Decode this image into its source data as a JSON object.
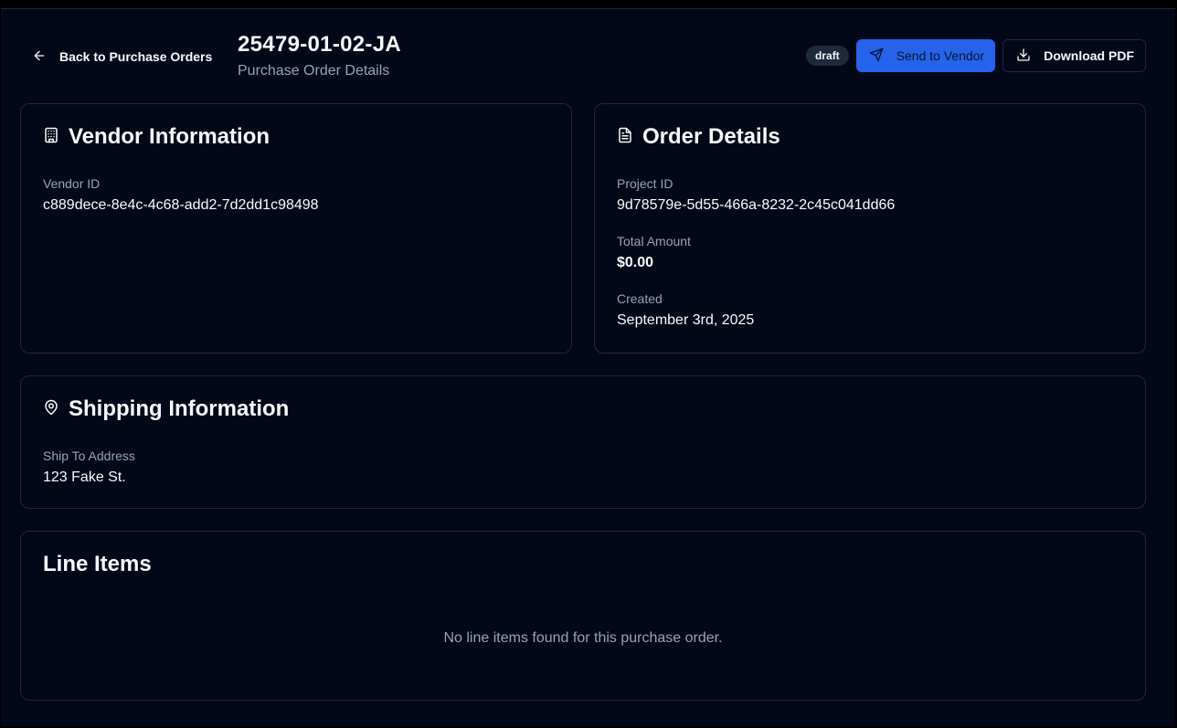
{
  "header": {
    "back_label": "Back to Purchase Orders",
    "po_number": "25479-01-02-JA",
    "subtitle": "Purchase Order Details",
    "status_badge": "draft",
    "send_label": "Send to Vendor",
    "download_label": "Download PDF"
  },
  "vendor": {
    "title": "Vendor Information",
    "vendor_id_label": "Vendor ID",
    "vendor_id": "c889dece-8e4c-4c68-add2-7d2dd1c98498"
  },
  "order": {
    "title": "Order Details",
    "project_id_label": "Project ID",
    "project_id": "9d78579e-5d55-466a-8232-2c45c041dd66",
    "total_label": "Total Amount",
    "total": "$0.00",
    "created_label": "Created",
    "created": "September 3rd, 2025"
  },
  "shipping": {
    "title": "Shipping Information",
    "address_label": "Ship To Address",
    "address": "123 Fake St."
  },
  "line_items": {
    "title": "Line Items",
    "empty_message": "No line items found for this purchase order."
  },
  "colors": {
    "background": "#020817",
    "border": "#1e293b",
    "primary": "#2563eb",
    "muted_text": "#94a3b8"
  }
}
